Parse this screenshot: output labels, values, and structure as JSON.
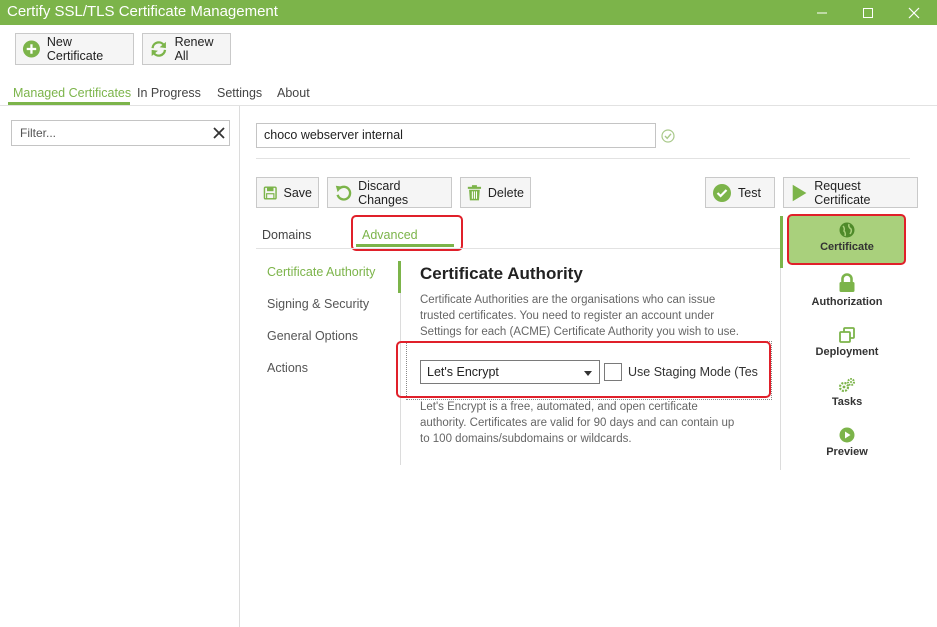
{
  "window": {
    "title": "Certify SSL/TLS Certificate Management"
  },
  "toolbar": {
    "new_certificate": "New Certificate",
    "renew_all": "Renew All"
  },
  "main_tabs": [
    {
      "label": "Managed Certificates",
      "active": true
    },
    {
      "label": "In Progress"
    },
    {
      "label": "Settings"
    },
    {
      "label": "About"
    }
  ],
  "filter": {
    "placeholder": "Filter..."
  },
  "certificate": {
    "name": "choco webserver internal"
  },
  "actions": {
    "save": "Save",
    "discard": "Discard Changes",
    "delete": "Delete",
    "test": "Test",
    "request": "Request Certificate"
  },
  "sub_tabs": [
    {
      "label": "Domains"
    },
    {
      "label": "Advanced",
      "active": true
    }
  ],
  "side_nav": [
    {
      "label": "Certificate Authority",
      "active": true
    },
    {
      "label": "Signing & Security"
    },
    {
      "label": "General Options"
    },
    {
      "label": "Actions"
    }
  ],
  "ca_section": {
    "title": "Certificate Authority",
    "desc_lines": [
      "Certificate Authorities are the organisations who can issue",
      "trusted certificates. You need to register an account under",
      "Settings for each (ACME) Certificate Authority you wish to use."
    ],
    "selected_ca": "Let's Encrypt",
    "staging_label": "Use Staging Mode (Test Certificates)",
    "info_lines": [
      "Let's Encrypt is a free, automated, and open certificate",
      "authority. Certificates are valid for 90 days and can contain up",
      "to 100 domains/subdomains or wildcards."
    ]
  },
  "right_nav": [
    {
      "label": "Certificate",
      "icon": "globe-icon",
      "active": true
    },
    {
      "label": "Authorization",
      "icon": "lock-icon"
    },
    {
      "label": "Deployment",
      "icon": "copy-icon"
    },
    {
      "label": "Tasks",
      "icon": "gears-icon"
    },
    {
      "label": "Preview",
      "icon": "play-circle-icon"
    }
  ],
  "colors": {
    "accent": "#7cb44a",
    "highlight": "#e0202a",
    "active_bg": "#a9d07c"
  }
}
